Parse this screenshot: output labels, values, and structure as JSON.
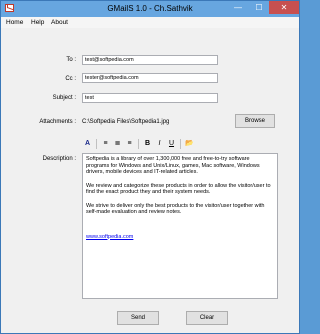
{
  "window": {
    "title": "GMailS 1.0 - Ch.Sathvik",
    "min_glyph": "—",
    "max_glyph": "☐",
    "close_glyph": "✕"
  },
  "menu": [
    "Home",
    "Help",
    "About"
  ],
  "form": {
    "to_label": "To :",
    "to_value": "test@softpedia.com",
    "cc_label": "Cc :",
    "cc_value": "tester@softpedia.com",
    "subject_label": "Subject :",
    "subject_value": "test",
    "attachments_label": "Attachments :",
    "attachment_path": "C:\\Softpedia Files\\Softpedia1.jpg",
    "browse_label": "Browse",
    "description_label": "Description :"
  },
  "toolbar": {
    "font_glyph": "A",
    "bold_glyph": "B",
    "italic_glyph": "I",
    "underline_glyph": "U",
    "align_left_glyph": "≡",
    "align_center_glyph": "≣",
    "align_right_glyph": "≡",
    "open_glyph": "📂"
  },
  "description": {
    "paragraph1": "Softpedia is a library of over 1,300,000 free and free-to-try software programs for Windows and Unix/Linux, games, Mac software, Windows drivers, mobile devices and IT-related articles.",
    "paragraph2": "We review and categorize these products in order to allow the visitor/user to find the exact product they and their system needs.",
    "paragraph3": "We strive to deliver only the best products to the visitor/user together with self-made evaluation and review notes.",
    "link": "www.softpedia.com"
  },
  "buttons": {
    "send": "Send",
    "clear": "Clear"
  },
  "colors": {
    "titlebar": "#67a6e0",
    "close": "#c75050",
    "link": "#0000ee"
  }
}
